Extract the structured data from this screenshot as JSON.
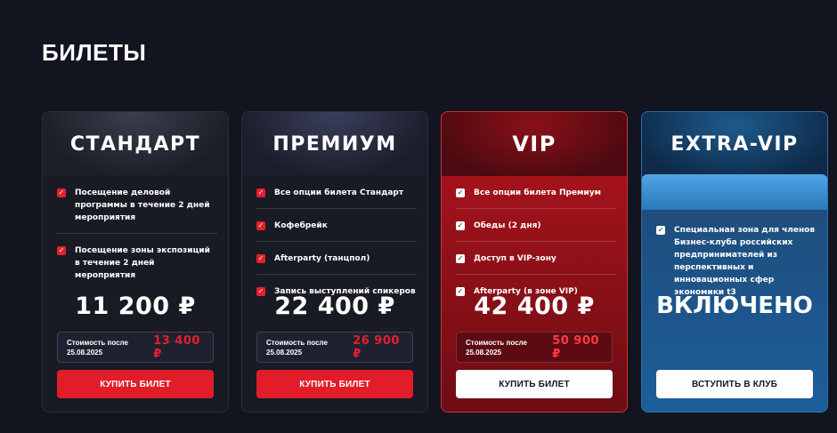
{
  "section": {
    "title": "БИЛЕТЫ"
  },
  "tickets": [
    {
      "name": "СТАНДАРТ",
      "features": [
        "Посещение деловой программы в течение 2 дней мероприятия",
        "Посещение зоны экспозиций в течение 2 дней мероприятия"
      ],
      "price": "11 200 ₽",
      "later_label": "Стоимость после 25.08.2025",
      "later_price": "13 400 ₽",
      "button": "КУПИТЬ БИЛЕТ"
    },
    {
      "name": "ПРЕМИУМ",
      "features": [
        "Все опции билета Стандарт",
        "Кофебрейк",
        "Afterparty (танцпол)",
        "Запись выступлений спикеров"
      ],
      "price": "22 400 ₽",
      "later_label": "Стоимость после 25.08.2025",
      "later_price": "26 900 ₽",
      "button": "КУПИТЬ БИЛЕТ"
    },
    {
      "name": "VIP",
      "features": [
        "Все опции билета Премиум",
        "Обеды (2 дня)",
        "Доступ в VIP-зону",
        "Afterparty (в зоне VIP)"
      ],
      "price": "42 400 ₽",
      "later_label": "Стоимость после 25.08.2025",
      "later_price": "50 900 ₽",
      "button": "КУПИТЬ БИЛЕТ"
    },
    {
      "name": "EXTRA-VIP",
      "features": [
        "Специальная зона для членов Бизнес-клуба российских предпринимателей из перспективных и инновационных сфер экономики t3"
      ],
      "price": "ВКЛЮЧЕНО",
      "button": "ВСТУПИТЬ В КЛУБ"
    }
  ],
  "icons": {
    "check": "checkbox-checked-icon"
  },
  "colors": {
    "accent": "#e11d2a",
    "background": "#121420",
    "vip": "#b3141c",
    "extra_vip": "#1d5c94"
  }
}
